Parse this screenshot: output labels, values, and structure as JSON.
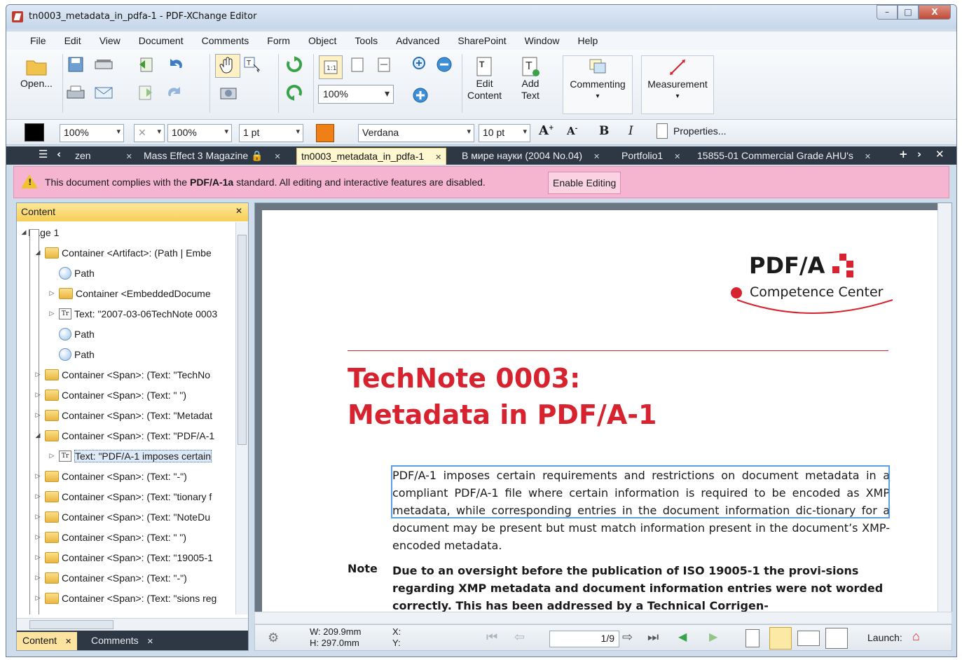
{
  "window": {
    "title": "tn0003_metadata_in_pdfa-1 - PDF-XChange Editor",
    "controls": [
      "–",
      "□",
      "X"
    ]
  },
  "menu": [
    "File",
    "Edit",
    "View",
    "Document",
    "Comments",
    "Form",
    "Object",
    "Tools",
    "Advanced",
    "SharePoint",
    "Window",
    "Help"
  ],
  "ribbon": {
    "open": "Open...",
    "zoom": "100%",
    "edit_content": [
      "Edit",
      "Content"
    ],
    "add_text": [
      "Add",
      "Text"
    ],
    "commenting": "Commenting",
    "measurement": "Measurement"
  },
  "props": {
    "fill_opacity": "100%",
    "stroke_opacity": "100%",
    "line_width": "1 pt",
    "font": "Verdana",
    "font_size": "10 pt",
    "properties": "Properties..."
  },
  "tabs": [
    "zen",
    "Mass Effect 3 Magazine",
    "tn0003_metadata_in_pdfa-1",
    "В мире науки (2004 No.04)",
    "Portfolio1",
    "15855-01 Commercial Grade AHU's"
  ],
  "notice": {
    "prefix": "This document complies with the ",
    "standard": "PDF/A-1a",
    "suffix": " standard. All editing and interactive features are disabled.",
    "button": "Enable Editing"
  },
  "content_panel": {
    "title": "Content",
    "items": [
      "Page 1",
      "Container <Artifact>: (Path | Embe",
      "Path",
      "Container <EmbeddedDocume",
      "Text: \"2007-03-06TechNote 0003",
      "Path",
      "Path",
      "Container <Span>: (Text: \"TechNo",
      "Container <Span>: (Text: \" \")",
      "Container <Span>: (Text: \"Metadat",
      "Container <Span>: (Text: \"PDF/A-1",
      "Text: \"PDF/A-1 imposes certain",
      "Container <Span>: (Text: \"-\")",
      "Container <Span>: (Text: \"tionary f",
      "Container <Span>: (Text: \"NoteDu",
      "Container <Span>: (Text: \" \")",
      "Container <Span>: (Text: \"19005-1",
      "Container <Span>: (Text: \"-\")",
      "Container <Span>: (Text: \"sions reg"
    ],
    "tabs": [
      "Content",
      "Comments"
    ]
  },
  "document": {
    "logo_title": "PDF/A",
    "logo_sub": "Competence Center",
    "heading1": "TechNote 0003:",
    "heading2": "Metadata in PDF/A-1",
    "paragraph": "PDF/A-1 imposes certain requirements and restrictions on document metadata in a compliant PDF/A-1 file where certain information is required to be encoded as XMP metadata, while corresponding entries in the document information dic-tionary for a document may be present but must match information present in the document’s XMP-encoded metadata.",
    "note_label": "Note",
    "note": "Due to an oversight before the publication of ISO 19005-1 the provi-sions regarding XMP metadata and document information entries were not worded correctly. This has been addressed by a Technical Corrigen-"
  },
  "status": {
    "width": "W: 209.9mm",
    "height": "H: 297.0mm",
    "x": "X:",
    "y": "Y:",
    "page": "1/9",
    "launch": "Launch:"
  },
  "colors": {
    "accent_red": "#d6232f",
    "tab_bar": "#2e3744",
    "notice_bg": "#f5b4cf",
    "panel_head": "#f7cf57"
  }
}
